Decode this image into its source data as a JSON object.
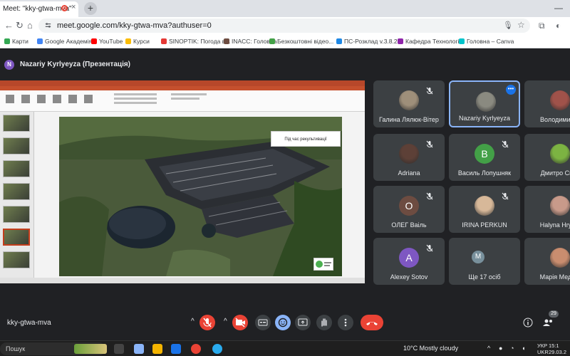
{
  "browser": {
    "tab_title": "Meet: \"kky-gtwa-mva\"",
    "tab_close": "×",
    "new_tab": "+",
    "minimize": "—",
    "url": "meet.google.com/kky-gtwa-mva?authuser=0",
    "bookmarks": [
      {
        "label": "Карти",
        "color": "#34a853"
      },
      {
        "label": "Google Академія",
        "color": "#4285f4"
      },
      {
        "label": "YouTube",
        "color": "#ff0000"
      },
      {
        "label": "Курси",
        "color": "#fbbc04"
      },
      {
        "label": "SINOPTIK: Погода в...",
        "color": "#e53935"
      },
      {
        "label": "INACC: Головна",
        "color": "#6d4c41"
      },
      {
        "label": "Безкоштовні відео...",
        "color": "#43a047"
      },
      {
        "label": "ПС-Розклад v.3.8.2",
        "color": "#1e88e5"
      },
      {
        "label": "Кафедра Технологі...",
        "color": "#8e24aa"
      },
      {
        "label": "Головна – Canva",
        "color": "#00c4cc"
      }
    ]
  },
  "meet": {
    "presenter_initial": "N",
    "presenter_title": "Nazariy Kyrlyeyza (Презентація)",
    "slide_label": "Під час рекультивації",
    "meeting_code": "kky-gtwa-mva",
    "participant_count": "29",
    "participants": [
      {
        "name": "Галина Лялюк-Вітер",
        "kind": "photo",
        "color": "#9e8f7a"
      },
      {
        "name": "Nazariy Kyrlyeyza",
        "kind": "photo",
        "color": "#8a8a80",
        "active": true
      },
      {
        "name": "Володимир Л",
        "kind": "photo",
        "color": "#a0524a"
      },
      {
        "name": "Adriana",
        "kind": "photo",
        "color": "#5d4037"
      },
      {
        "name": "Василь Лопушняк",
        "kind": "letter",
        "letter": "В",
        "color": "#43a047"
      },
      {
        "name": "Дмитро Скоб",
        "kind": "photo",
        "color": "#7cb342"
      },
      {
        "name": "ОЛЕГ Ваіль",
        "kind": "letter",
        "letter": "О",
        "color": "#6d4c41"
      },
      {
        "name": "IRINA PERKUN",
        "kind": "photo",
        "color": "#d7b899"
      },
      {
        "name": "Halyna Hrytsu",
        "kind": "photo",
        "color": "#c89a8a"
      },
      {
        "name": "Alexey Sotov",
        "kind": "letter",
        "letter": "A",
        "color": "#7e57c2"
      },
      {
        "name": "Ще 17 осіб",
        "kind": "group",
        "letter": "M",
        "color": "#78909c"
      },
      {
        "name": "Марія Медвід",
        "kind": "photo",
        "color": "#c98d6f"
      }
    ],
    "reactions": [
      "💖",
      "👍",
      "🎉",
      "👏",
      "😂",
      "😮",
      "😢",
      "🤔",
      "👎"
    ]
  },
  "taskbar": {
    "search_placeholder": "Пошук",
    "weather": "10°C  Mostly cloudy",
    "language_top": "УКР",
    "language_bottom": "UKR",
    "time": "15:1",
    "date": "29.03.2"
  }
}
